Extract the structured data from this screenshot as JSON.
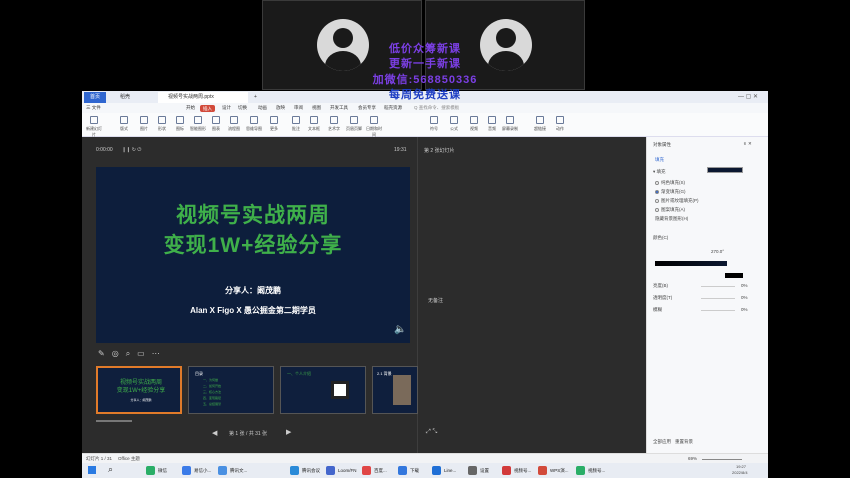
{
  "watermark": {
    "line1": "低价众筹新课",
    "line2": "更新一手新课",
    "line3": "加微信:568850336",
    "line4": "每周免费送课"
  },
  "window": {
    "home_tab": "首页",
    "tab2": "稻壳",
    "doc_tab": "视频号实战两周.pptx",
    "new_tab": "+"
  },
  "ribbon_tabs": [
    "三 文件",
    "开始",
    "插入",
    "设计",
    "切换",
    "动画",
    "放映",
    "审阅",
    "视图",
    "开发工具",
    "会员专享",
    "稻壳资源"
  ],
  "search_placeholder": "Q 查找命令、搜索模板",
  "toolbar": [
    "新建幻灯片",
    "版式",
    "图片",
    "形状",
    "图标",
    "智能图形",
    "图表",
    "流程图",
    "思维导图",
    "更多",
    "批注",
    "文本框",
    "艺术字",
    "页眉页脚",
    "日期和时间",
    "符号",
    "公式",
    "视频",
    "音频",
    "屏幕录制",
    "超链接",
    "动作"
  ],
  "presenter": {
    "timer": "0:00:00",
    "clock": "19:31",
    "next_label": "第 2 张幻灯片",
    "notes_label": "无备注",
    "slide_counter": "第 1 张 / 共 31 张"
  },
  "slide": {
    "title1": "视频号实战两周",
    "title2": "变现1W+经验分享",
    "speaker": "分享人：阚茂鹏",
    "credit": "Alan X Figo X 愚公掘金第二期学员"
  },
  "thumbs": [
    {
      "t1": "视频号实战两周",
      "t2": "变现1W+经验分享",
      "t3": "分享人：阚茂鹏"
    },
    {
      "t1": "目录",
      "items": [
        "一、为何做",
        "二、如何开始",
        "三、核心方法",
        "四、变现路径",
        "五、总结展望"
      ]
    },
    {
      "t1": "一、个人介绍"
    },
    {
      "t1": "2.1 背景"
    }
  ],
  "side_panel": {
    "title": "对象属性",
    "fill_label": "填充",
    "section": "▾ 填充",
    "options": [
      "纯色填充(S)",
      "渐变填充(G)",
      "图片或纹理填充(P)",
      "图案填充(A)",
      "隐藏背景图形(H)"
    ],
    "color_label": "颜色(C)",
    "brightness": "亮度(B)",
    "transparency": "透明度(T)",
    "blur": "模糊",
    "angle": "270.0°",
    "val1": "0%",
    "val2": "0%",
    "val3": "0%",
    "apply_all": "全部应用",
    "reset": "重置背景"
  },
  "status": {
    "left": "幻灯片 1 / 31",
    "theme": "Office 主题",
    "zoom": "69%",
    "time": "19:27",
    "date": "2022/8/4"
  },
  "taskbar": [
    "微信",
    "易信小...",
    "腾讯文...",
    "腾讯会议",
    "Loom/FN",
    "百度...",
    "下载",
    "Line...",
    "设置",
    "视频号...",
    "WPS演...",
    "视频号..."
  ]
}
